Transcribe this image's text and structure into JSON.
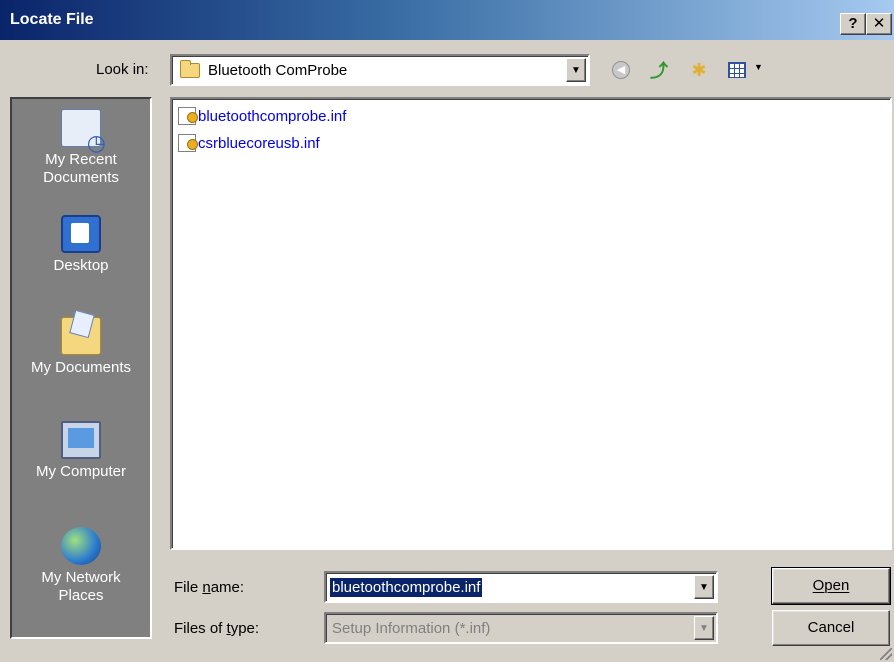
{
  "window": {
    "title": "Locate File",
    "help_label": "?",
    "close_label": "✕"
  },
  "look_in": {
    "label": "Look in:",
    "value": "Bluetooth ComProbe",
    "toolbar_icons": [
      "back-icon",
      "up-folder-icon",
      "new-folder-icon",
      "views-menu-icon"
    ]
  },
  "places": [
    {
      "label": "My Recent\nDocuments",
      "icon": "recent-documents-icon"
    },
    {
      "label": "Desktop",
      "icon": "desktop-icon"
    },
    {
      "label": "My Documents",
      "icon": "my-documents-icon"
    },
    {
      "label": "My Computer",
      "icon": "my-computer-icon"
    },
    {
      "label": "My Network\nPlaces",
      "icon": "network-places-icon"
    }
  ],
  "files": [
    {
      "name": "bluetoothcomprobe.inf",
      "icon": "inf-file-icon"
    },
    {
      "name": "csrbluecoreusb.inf",
      "icon": "inf-file-icon"
    }
  ],
  "file_name": {
    "label": "File name:",
    "value": "bluetoothcomprobe.inf"
  },
  "file_type": {
    "label": "Files of type:",
    "value": "Setup Information (*.inf)"
  },
  "buttons": {
    "open": "Open",
    "cancel": "Cancel"
  },
  "colors": {
    "title_bar": "#0a246a",
    "dialog_bg": "#d4d0c8",
    "places_bg": "#808080",
    "file_link": "#0000ee",
    "selection": "#0a246a"
  }
}
